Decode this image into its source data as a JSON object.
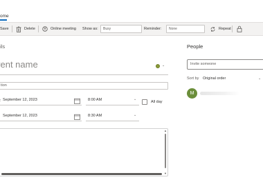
{
  "tabs": {
    "home": "ome"
  },
  "toolbar": {
    "save_label": "Save",
    "delete_label": "Delete",
    "online_meeting_label": "Online meeting",
    "show_as_label": "Show as:",
    "show_as_value": "Busy",
    "reminder_label": "Reminder:",
    "reminder_value": "None",
    "repeat_label": "Repeat"
  },
  "details": {
    "section_title": "ils",
    "event_name_placeholder": "vent name",
    "location_placeholder": "tion",
    "start_date_label": ":",
    "start_date": "September 12, 2023",
    "start_time": "8:00 AM",
    "all_day_label": "All day",
    "end_date": "September 12, 2023",
    "end_time": "8:30 AM"
  },
  "people": {
    "title": "People",
    "invite_placeholder": "Invite someone",
    "sort_label": "Sort by",
    "sort_value": "Original order",
    "attendee_initial": "M"
  },
  "colors": {
    "accent": "#0f6cbd",
    "status_busy": "#8a9a3b",
    "avatar_bg": "#6b8e3a"
  }
}
